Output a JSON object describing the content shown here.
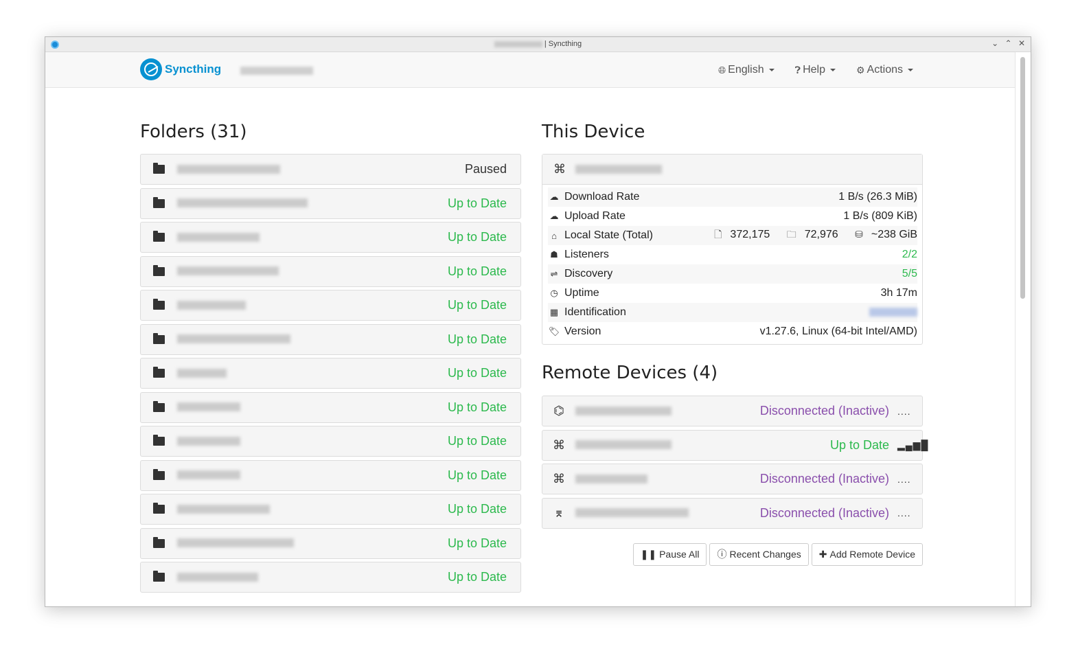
{
  "window": {
    "title": "| Syncthing",
    "controls": [
      "⌄",
      "⌃",
      "✕"
    ]
  },
  "navbar": {
    "brand": "Syncthing",
    "language_label": "English",
    "help_label": "Help",
    "actions_label": "Actions"
  },
  "folders": {
    "heading": "Folders (31)",
    "items": [
      {
        "status": "Paused",
        "name_width": 150
      },
      {
        "status": "Up to Date",
        "name_width": 190
      },
      {
        "status": "Up to Date",
        "name_width": 120
      },
      {
        "status": "Up to Date",
        "name_width": 148
      },
      {
        "status": "Up to Date",
        "name_width": 100
      },
      {
        "status": "Up to Date",
        "name_width": 165
      },
      {
        "status": "Up to Date",
        "name_width": 72
      },
      {
        "status": "Up to Date",
        "name_width": 92
      },
      {
        "status": "Up to Date",
        "name_width": 92
      },
      {
        "status": "Up to Date",
        "name_width": 92
      },
      {
        "status": "Up to Date",
        "name_width": 135
      },
      {
        "status": "Up to Date",
        "name_width": 170
      },
      {
        "status": "Up to Date",
        "name_width": 118
      }
    ]
  },
  "this_device": {
    "heading": "This Device",
    "rows": {
      "download_label": "Download Rate",
      "download_value": "1 B/s (26.3 MiB)",
      "upload_label": "Upload Rate",
      "upload_value": "1 B/s (809 KiB)",
      "local_state_label": "Local State (Total)",
      "local_files": "372,175",
      "local_dirs": "72,976",
      "local_size": "~238 GiB",
      "listeners_label": "Listeners",
      "listeners_value": "2/2",
      "discovery_label": "Discovery",
      "discovery_value": "5/5",
      "uptime_label": "Uptime",
      "uptime_value": "3h 17m",
      "identification_label": "Identification",
      "version_label": "Version",
      "version_value": "v1.27.6, Linux (64-bit Intel/AMD)"
    }
  },
  "remote_devices": {
    "heading": "Remote Devices (4)",
    "items": [
      {
        "status": "Disconnected (Inactive)",
        "signal": "....",
        "kind": "disc"
      },
      {
        "status": "Up to Date",
        "signal": "▂▄▆█",
        "kind": "up"
      },
      {
        "status": "Disconnected (Inactive)",
        "signal": "....",
        "kind": "disc"
      },
      {
        "status": "Disconnected (Inactive)",
        "signal": "....",
        "kind": "disc"
      }
    ]
  },
  "buttons": {
    "pause_all": "Pause All",
    "recent_changes": "Recent Changes",
    "add_remote": "Add Remote Device"
  },
  "colors": {
    "brand": "#0891d1",
    "up_to_date": "#2cb94d",
    "disconnected": "#8a4fac"
  }
}
